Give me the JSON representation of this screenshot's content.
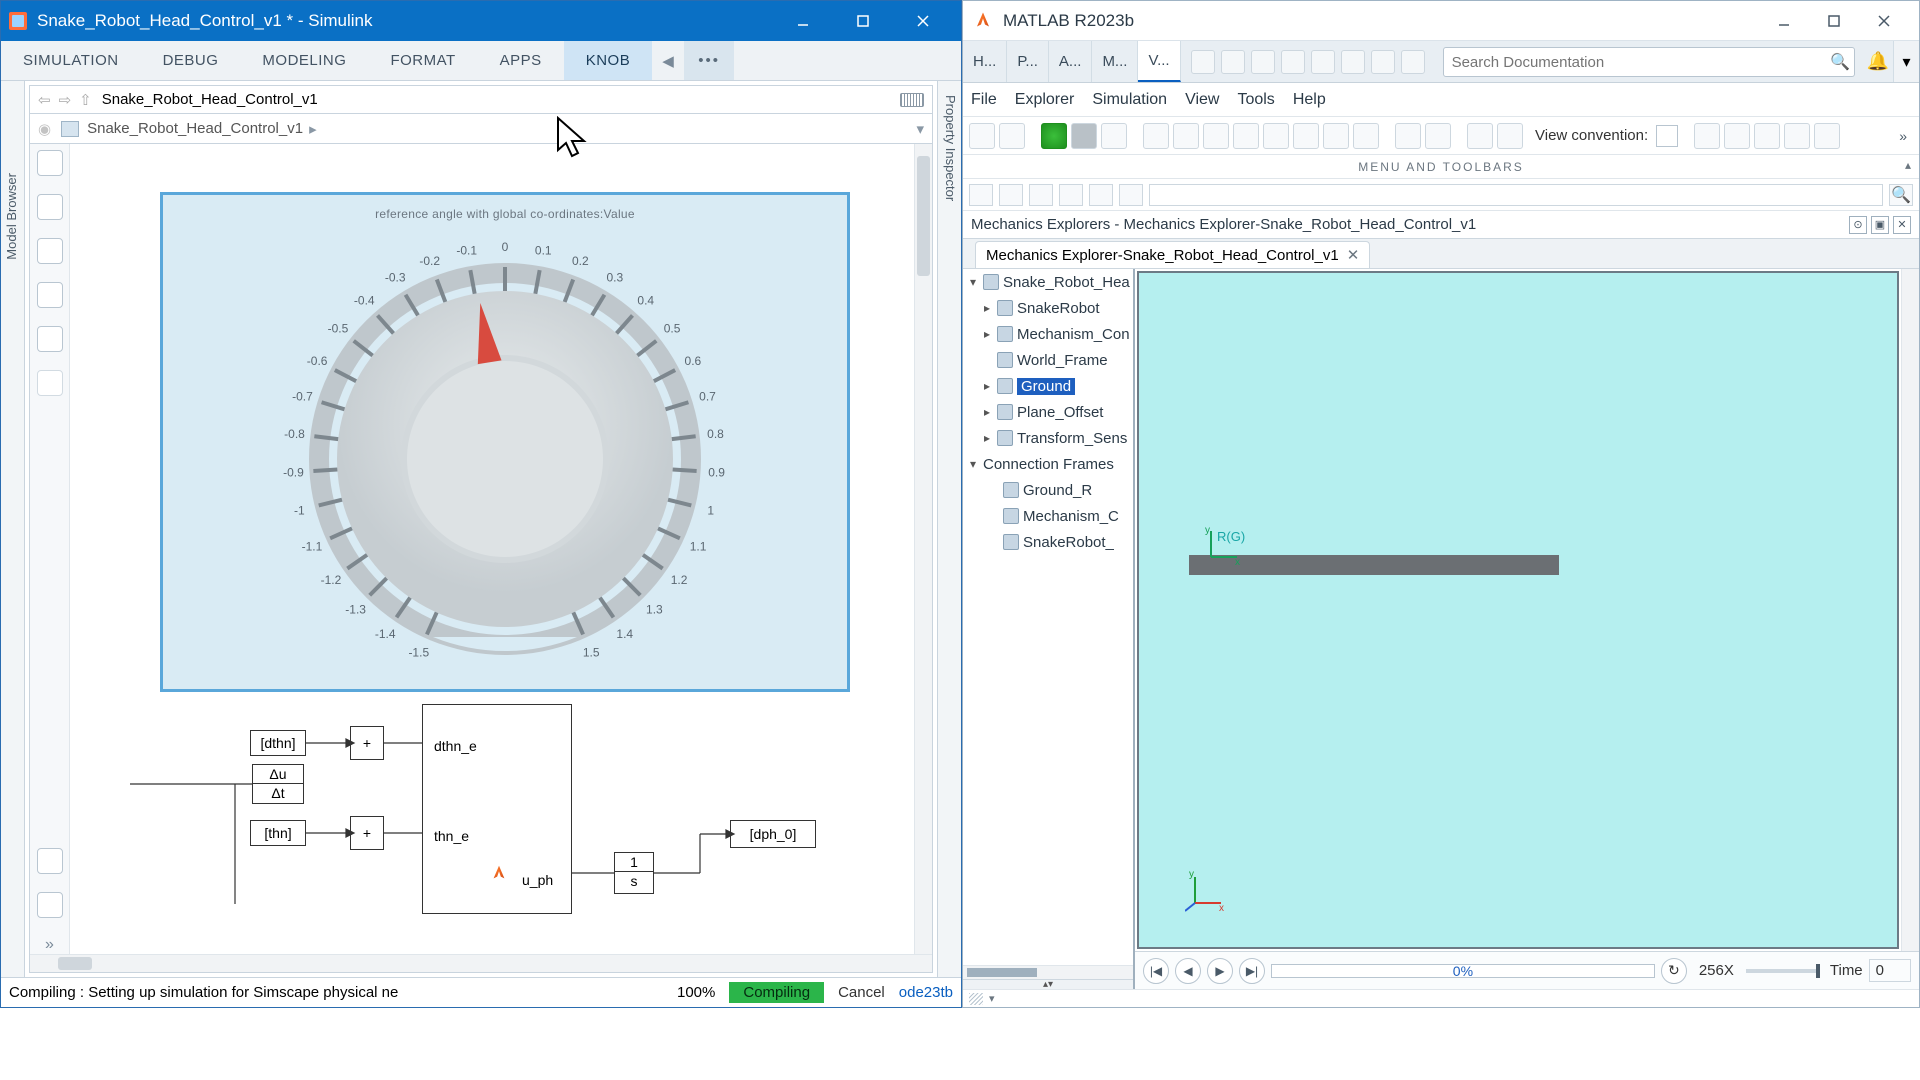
{
  "simulink": {
    "title": "Snake_Robot_Head_Control_v1 * - Simulink",
    "tabs": [
      "SIMULATION",
      "DEBUG",
      "MODELING",
      "FORMAT",
      "APPS",
      "KNOB"
    ],
    "tabs_more": "•••",
    "breadcrumb": "Snake_Robot_Head_Control_v1",
    "breadcrumb2": "Snake_Robot_Head_Control_v1",
    "left_rail": "Model Browser",
    "right_rail": "Property Inspector",
    "knob": {
      "title": "reference angle with global co-ordinates:Value",
      "ticks": [
        "-1.5",
        "-1.4",
        "-1.3",
        "-1.2",
        "-1.1",
        "-1",
        "-0.9",
        "-0.8",
        "-0.7",
        "-0.6",
        "-0.5",
        "-0.4",
        "-0.3",
        "-0.2",
        "-0.1",
        "0",
        "0.1",
        "0.2",
        "0.3",
        "0.4",
        "0.5",
        "0.6",
        "0.7",
        "0.8",
        "0.9",
        "1",
        "1.1",
        "1.2",
        "1.3",
        "1.4",
        "1.5"
      ],
      "pointer_value": "-0.1"
    },
    "blocks": {
      "tag_dthn": "[dthn]",
      "tag_thn": "[thn]",
      "dthn_e": "dthn_e",
      "thn_e": "thn_e",
      "u_ph": "u_ph",
      "deriv_top": "Δu",
      "deriv_bot": "Δt",
      "integ_top": "1",
      "integ_bot": "s",
      "tag_dph0": "[dph_0]"
    },
    "status": {
      "msg": "Compiling : Setting up simulation for Simscape physical ne",
      "pct": "100%",
      "compile": "Compiling",
      "cancel": "Cancel",
      "solver": "ode23tb"
    }
  },
  "matlab": {
    "title": "MATLAB R2023b",
    "tabs": [
      "H...",
      "P...",
      "A...",
      "M...",
      "V..."
    ],
    "search_placeholder": "Search Documentation",
    "menus": [
      "File",
      "Explorer",
      "Simulation",
      "View",
      "Tools",
      "Help"
    ],
    "view_conv": "View convention:",
    "toolbar_caption": "MENU AND TOOLBARS",
    "dock_title": "Mechanics Explorers - Mechanics Explorer-Snake_Robot_Head_Control_v1",
    "doc_tab": "Mechanics Explorer-Snake_Robot_Head_Control_v1",
    "tree": {
      "root": "Snake_Robot_Hea",
      "items": [
        "SnakeRobot",
        "Mechanism_Con",
        "World_Frame",
        "Ground",
        "Plane_Offset",
        "Transform_Sens"
      ],
      "conn": "Connection Frames",
      "conn_items": [
        "Ground_R",
        "Mechanism_C",
        "SnakeRobot_"
      ]
    },
    "frame_label": "R(G)",
    "playbar": {
      "pct": "0%",
      "speed": "256X",
      "time_label": "Time",
      "time_val": "0"
    }
  },
  "colors": {
    "sl_accent": "#0a70c5",
    "knob_border": "#5aa7da",
    "run_green": "#2bb54a",
    "sel_blue": "#1e5fbf",
    "view_bg": "#b5efef"
  }
}
